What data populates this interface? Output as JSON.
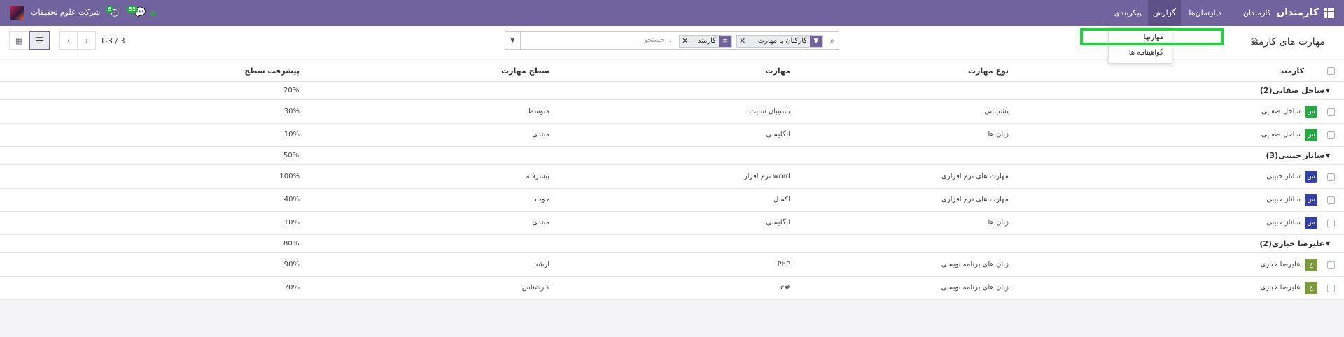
{
  "navbar": {
    "brand": "کارمندان",
    "menu": [
      "کارمندان",
      "دپارتمان‌ها",
      "گزارش",
      "پیکربندی"
    ],
    "company": "شرکت علوم تحقیقات",
    "activity_count": "6",
    "messages_count": "55",
    "colors": {
      "bar": "#71639e",
      "badge": "#28a745"
    }
  },
  "control": {
    "title": "مهارت های کارمند",
    "facets": [
      {
        "icon": "filter-icon",
        "label": "کارکنان با مهارت"
      },
      {
        "icon": "group-by-icon",
        "label": "کارمند"
      }
    ],
    "search_placeholder": "جستجو...",
    "pager": "1-3 / 3"
  },
  "dropdown": {
    "items": [
      "مهارتها",
      "گواهینامه ها"
    ]
  },
  "columns": {
    "employee": "کارمند",
    "skill_type": "نوع مهارت",
    "skill": "مهارت",
    "level": "سطح مهارت",
    "progress": "پیشرفت سطح"
  },
  "groups": [
    {
      "title": "ساحل صفایی(2)",
      "progress": "20%",
      "rows": [
        {
          "initial": "س",
          "employee": "ساحل صفایی",
          "skill_type": "پشتیبانی",
          "skill": "پشتیبان سایت",
          "level": "متوسط",
          "progress": "30%"
        },
        {
          "initial": "س",
          "employee": "ساحل صفایی",
          "skill_type": "زبان ها",
          "skill": "انگلیسی",
          "level": "مبتدی",
          "progress": "10%"
        }
      ]
    },
    {
      "title": "ساناز حبیبی(3)",
      "progress": "50%",
      "rows": [
        {
          "initial": "س",
          "employee": "ساناز حبیبی",
          "skill_type": "مهارت های نرم افزاری",
          "skill": "نرم افزار word",
          "level": "پیشرفته",
          "progress": "100%"
        },
        {
          "initial": "س",
          "employee": "ساناز حبیبی",
          "skill_type": "مهارت های نرم افزاری",
          "skill": "اکسل",
          "level": "خوب",
          "progress": "40%"
        },
        {
          "initial": "س",
          "employee": "ساناز حبیبی",
          "skill_type": "زبان ها",
          "skill": "انگلیسی",
          "level": "مبتدی",
          "progress": "10%"
        }
      ]
    },
    {
      "title": "علیرضا خبازی(2)",
      "progress": "80%",
      "rows": [
        {
          "initial": "ع",
          "employee": "علیرضا خبازی",
          "skill_type": "زبان های برنامه نویسی",
          "skill": "PhP",
          "level": "ارشد",
          "progress": "90%"
        },
        {
          "initial": "ع",
          "employee": "علیرضا خبازی",
          "skill_type": "زبان های برنامه نویسی",
          "skill": "c#",
          "level": "کارشناس",
          "progress": "70%"
        }
      ]
    }
  ],
  "badge_colors": {
    "green": "#28a745",
    "blue": "#3341a6",
    "olive": "#7c9a3a"
  }
}
